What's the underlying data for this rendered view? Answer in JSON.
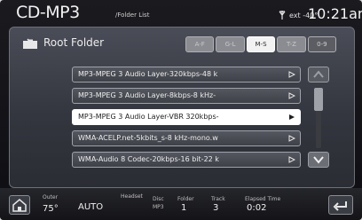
{
  "header": {
    "title": "CD-MP3",
    "subtitle": "/Folder List",
    "temperature": "ext -40°",
    "time": "10:21am"
  },
  "panel": {
    "folder_label": "Root Folder",
    "segments": [
      {
        "label": "A-F"
      },
      {
        "label": "G-L"
      },
      {
        "label": "M-S"
      },
      {
        "label": "T-Z"
      },
      {
        "label": "0-9"
      }
    ],
    "tracks": [
      {
        "label": "MP3-MPEG 3 Audio Layer-320kbps-48 k"
      },
      {
        "label": "MP3-MPEG 3 Audio Layer-8kbps-8 kHz-"
      },
      {
        "label": "MP3-MPEG 3 Audio Layer-VBR 320kbps-"
      },
      {
        "label": "WMA-ACELP.net-5kbits_s-8 kHz-mono.w"
      },
      {
        "label": "WMA-Audio 8 Codec-20kbps-16 bit-22 k"
      }
    ]
  },
  "bottom": {
    "outer_label": "Outer",
    "outer_temp": "75°",
    "climate_mode": "AUTO",
    "headset_label": "Headset",
    "disc_label": "Disc",
    "mp3_label": "MP3",
    "folder_label": "Folder",
    "folder_value": "1",
    "track_label": "Track",
    "track_value": "3",
    "elapsed_label": "Elapsed Time",
    "elapsed_value": "0:02"
  }
}
